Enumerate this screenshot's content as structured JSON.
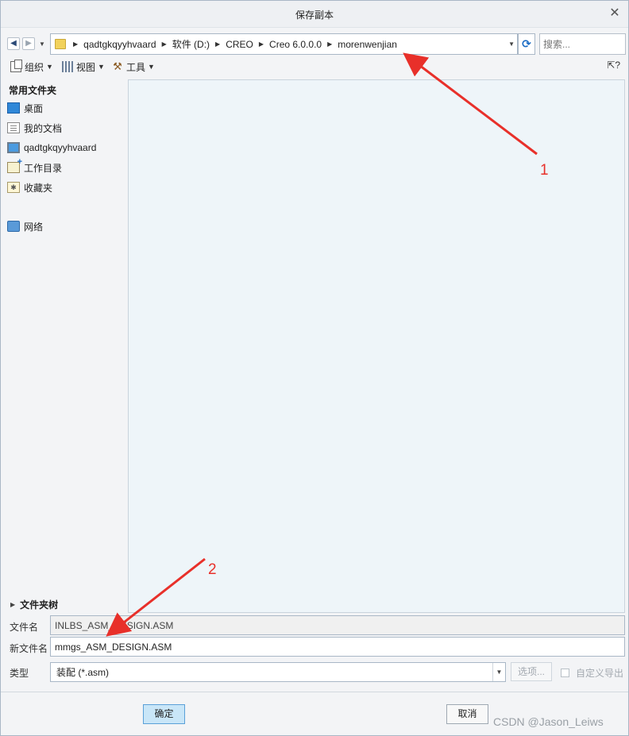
{
  "window": {
    "title": "保存副本"
  },
  "navigation": {
    "breadcrumbs": [
      "qadtgkqyyhvaard",
      "软件 (D:)",
      "CREO",
      "Creo 6.0.0.0",
      "morenwenjian"
    ],
    "search_placeholder": "搜索..."
  },
  "toolbar": {
    "organize_label": "组织",
    "view_label": "视图",
    "tools_label": "工具",
    "help_icon": "help-pointer-icon"
  },
  "sidebar": {
    "header": "常用文件夹",
    "items": [
      {
        "label": "桌面",
        "icon": "desktop-icon"
      },
      {
        "label": "我的文档",
        "icon": "documents-icon"
      },
      {
        "label": "qadtgkqyyhvaard",
        "icon": "computer-icon"
      },
      {
        "label": "工作目录",
        "icon": "working-directory-icon"
      },
      {
        "label": "收藏夹",
        "icon": "favorites-icon"
      },
      {
        "label": "网络",
        "icon": "network-icon"
      }
    ]
  },
  "folder_tree": {
    "label": "文件夹树"
  },
  "form": {
    "filename_label": "文件名",
    "filename_value": "INLBS_ASM_DESIGN.ASM",
    "new_filename_label": "新文件名",
    "new_filename_value": "mmgs_ASM_DESIGN.ASM",
    "type_label": "类型",
    "type_value": "装配 (*.asm)",
    "options_label": "选项...",
    "custom_export_label": "自定义导出"
  },
  "buttons": {
    "ok_label": "确定",
    "cancel_label": "取消"
  },
  "annotations": [
    {
      "label": "1",
      "color": "#e8302a"
    },
    {
      "label": "2",
      "color": "#e8302a"
    }
  ],
  "watermark": "CSDN @Jason_Leiws"
}
